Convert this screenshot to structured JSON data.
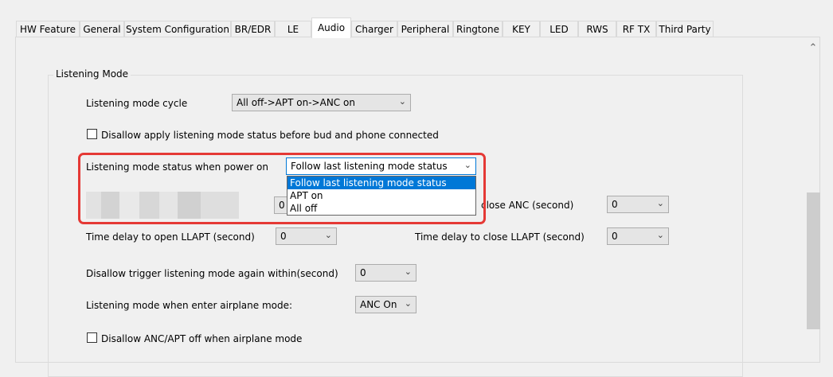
{
  "tabs": [
    {
      "label": "HW Feature"
    },
    {
      "label": "General"
    },
    {
      "label": "System Configuration"
    },
    {
      "label": "BR/EDR"
    },
    {
      "label": "LE"
    },
    {
      "label": "Audio"
    },
    {
      "label": "Charger"
    },
    {
      "label": "Peripheral"
    },
    {
      "label": "Ringtone"
    },
    {
      "label": "KEY"
    },
    {
      "label": "LED"
    },
    {
      "label": "RWS"
    },
    {
      "label": "RF TX"
    },
    {
      "label": "Third Party"
    }
  ],
  "active_tab": "Audio",
  "group": {
    "title": "Listening Mode"
  },
  "fields": {
    "cycle": {
      "label": "Listening mode cycle",
      "value": "All off->APT on->ANC on"
    },
    "disallow_apply": {
      "label": "Disallow apply listening mode status before bud and phone connected"
    },
    "power_on": {
      "label": "Listening mode status when power on",
      "value": "Follow last listening mode status",
      "options": [
        "Follow last listening mode status",
        "APT on",
        "All off"
      ]
    },
    "open_anc": {
      "value": "0"
    },
    "close_anc": {
      "label": "close ANC (second)",
      "value": "0"
    },
    "open_llapt": {
      "label": "Time delay to open LLAPT (second)",
      "value": "0"
    },
    "close_llapt": {
      "label": "Time delay to close LLAPT (second)",
      "value": "0"
    },
    "trigger_again": {
      "label": "Disallow trigger listening mode again within(second)",
      "value": "0"
    },
    "airplane": {
      "label": "Listening mode when enter airplane mode:",
      "value": "ANC On"
    },
    "disallow_off_airplane": {
      "label": "Disallow ANC/APT off when airplane mode"
    }
  },
  "colors": {
    "highlight": "#e53935",
    "selection": "#0078d7"
  }
}
